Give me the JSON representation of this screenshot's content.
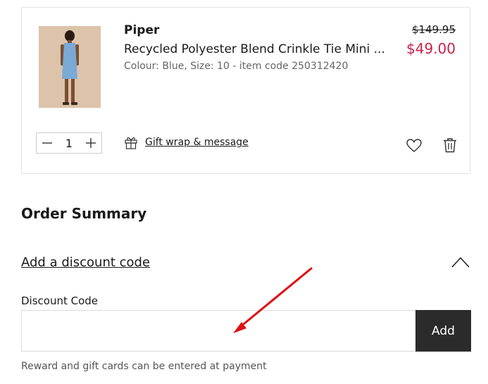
{
  "cart_item": {
    "image_alt": "Model wearing blue crinkle tie mini dress",
    "brand": "Piper",
    "title": "Recycled Polyester Blend Crinkle Tie Mini ...",
    "details": "Colour: Blue, Size: 10 - item code 250312420",
    "original_price": "$149.95",
    "sale_price": "$49.00",
    "quantity": "1",
    "gift_wrap_label": "Gift wrap & message",
    "icons": {
      "decrease": "minus-icon",
      "increase": "plus-icon",
      "gift": "gift-icon",
      "wishlist": "heart-icon",
      "remove": "trash-icon"
    }
  },
  "order_summary": {
    "title": "Order Summary",
    "discount_toggle_label": "Add a discount code",
    "discount_field_label": "Discount Code",
    "discount_placeholder": "",
    "add_button_label": "Add",
    "payment_note": "Reward and gift cards can be entered at payment"
  },
  "colors": {
    "sale_price": "#c8234a",
    "button_bg": "#2b2b2b",
    "annotation_arrow": "#e01010"
  }
}
